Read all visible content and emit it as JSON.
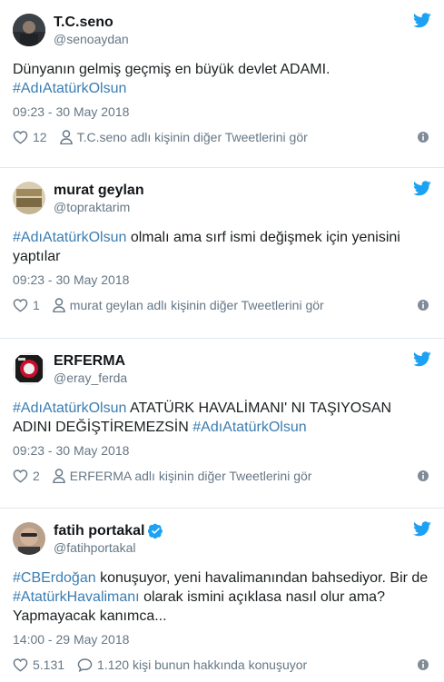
{
  "colors": {
    "link": "#3b7db1",
    "twitter_blue": "#1da1f2",
    "muted": "#657786"
  },
  "tweets": [
    {
      "name": "T.C.seno",
      "handle": "@senoaydan",
      "verified": false,
      "text": [
        {
          "t": "Dünyanın gelmiş geçmiş en büyük devlet ADAMI.",
          "tag": false,
          "br": true
        },
        {
          "t": "#AdıAtatürkOlsun",
          "tag": true
        }
      ],
      "time": "09:23 - 30 May 2018",
      "likes": "12",
      "second_action": "T.C.seno adlı kişinin diğer Tweetlerini gör",
      "second_icon": "person-icon"
    },
    {
      "name": "murat geylan",
      "handle": "@topraktarim",
      "verified": false,
      "text": [
        {
          "t": "#AdıAtatürkOlsun",
          "tag": true
        },
        {
          "t": " olmalı ama sırf ismi değişmek için yenisini yaptılar",
          "tag": false
        }
      ],
      "time": "09:23 - 30 May 2018",
      "likes": "1",
      "second_action": "murat geylan adlı kişinin diğer Tweetlerini gör",
      "second_icon": "person-icon"
    },
    {
      "name": "ERFERMA",
      "handle": "@eray_ferda",
      "verified": false,
      "text": [
        {
          "t": "#AdıAtatürkOlsun",
          "tag": true
        },
        {
          "t": " ATATÜRK HAVALİMANI' NI TAŞIYOSAN ADINI DEĞİŞTİREMEZSİN ",
          "tag": false
        },
        {
          "t": "#AdıAtatürkOlsun",
          "tag": true
        }
      ],
      "time": "09:23 - 30 May 2018",
      "likes": "2",
      "second_action": "ERFERMA adlı kişinin diğer Tweetlerini gör",
      "second_icon": "person-icon"
    },
    {
      "name": "fatih portakal",
      "handle": "@fatihportakal",
      "verified": true,
      "text": [
        {
          "t": "#CBErdoğan",
          "tag": true
        },
        {
          "t": " konuşuyor, yeni havalimanından bahsediyor. Bir de ",
          "tag": false
        },
        {
          "t": "#AtatürkHavalimanı",
          "tag": true
        },
        {
          "t": " olarak ismini açıklasa nasıl olur ama? Yapmayacak kanımca...",
          "tag": false
        }
      ],
      "time": "14:00 - 29 May 2018",
      "likes": "5.131",
      "second_action": "1.120 kişi bunun hakkında konuşuyor",
      "second_icon": "reply-icon"
    }
  ]
}
